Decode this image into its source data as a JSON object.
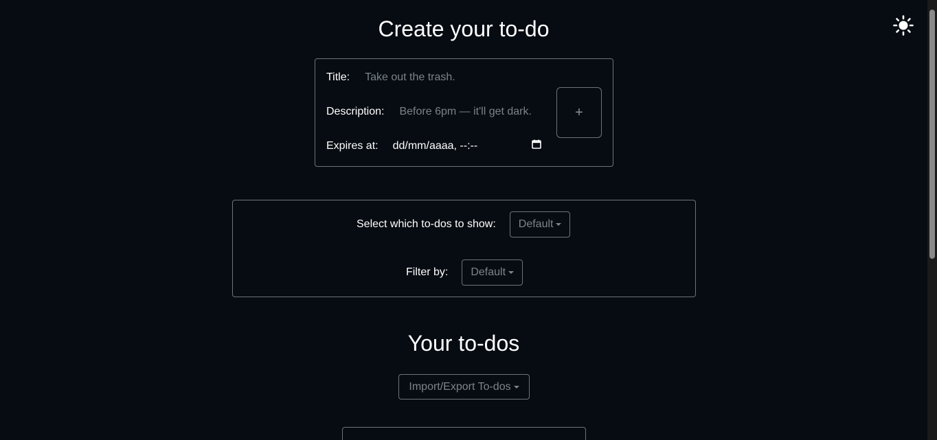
{
  "create": {
    "heading": "Create your to-do",
    "title_label": "Title:",
    "title_placeholder": "Take out the trash.",
    "description_label": "Description:",
    "description_placeholder": "Before 6pm — it'll get dark.",
    "expires_label": "Expires at:",
    "expires_value": "dd/mm/aaaa, --:--",
    "add_button_label": "+"
  },
  "filters": {
    "show_label": "Select which to-dos to show:",
    "show_value": "Default",
    "filter_label": "Filter by:",
    "filter_value": "Default"
  },
  "list": {
    "heading": "Your to-dos",
    "import_export_label": "Import/Export To-dos"
  },
  "icons": {
    "theme_toggle": "sun-icon",
    "calendar": "calendar-icon"
  },
  "colors": {
    "background": "#070c12",
    "border": "#6c757d",
    "placeholder": "#7b828a"
  }
}
